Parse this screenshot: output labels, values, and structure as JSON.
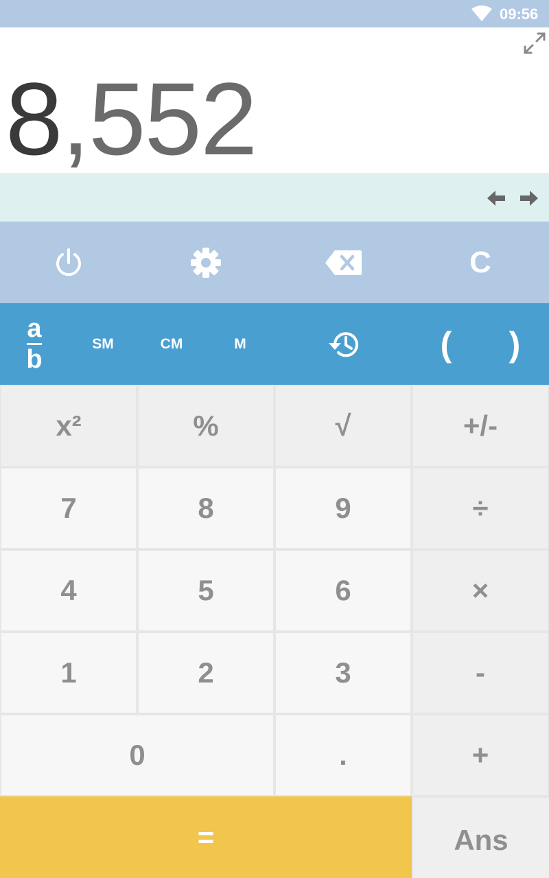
{
  "status_bar": {
    "time": "09:56",
    "wifi_icon": "wifi-icon"
  },
  "display": {
    "value_first": "8",
    "value_rest": ",552",
    "expand_icon": "expand-icon"
  },
  "expression_bar": {
    "left_icon": "arrow-left-icon",
    "right_icon": "arrow-right-icon"
  },
  "controls": {
    "power_icon": "power-icon",
    "settings_icon": "gear-icon",
    "backspace_icon": "backspace-icon",
    "clear_label": "C"
  },
  "memory_row": {
    "fraction_top": "a",
    "fraction_bottom": "b",
    "sm": "SM",
    "cm": "CM",
    "m": "M",
    "history_icon": "history-icon",
    "paren_open": "(",
    "paren_close": ")"
  },
  "keys": {
    "square": "x²",
    "percent": "%",
    "sqrt": "√",
    "negate": "+/-",
    "seven": "7",
    "eight": "8",
    "nine": "9",
    "divide": "÷",
    "four": "4",
    "five": "5",
    "six": "6",
    "multiply": "×",
    "one": "1",
    "two": "2",
    "three": "3",
    "minus": "-",
    "zero": "0",
    "decimal": ".",
    "plus": "+",
    "equals": "=",
    "ans": "Ans"
  },
  "colors": {
    "status_bar": "#b1c9e3",
    "expression_bar": "#dff0f1",
    "controls_row": "#b1c9e3",
    "memory_row": "#4a9fd1",
    "equals_key": "#f2c64c"
  }
}
